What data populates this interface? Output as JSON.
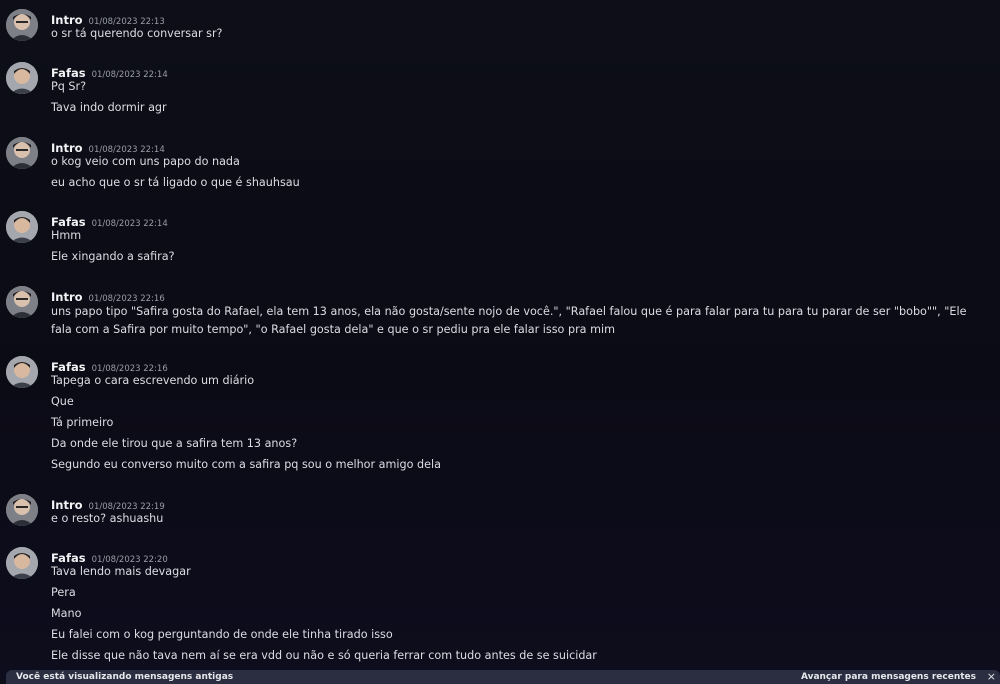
{
  "messages": [
    {
      "author": "Intro",
      "time": "01/08/2023 22:13",
      "avatar": "avatar-intro",
      "lines": [
        "o sr tá querendo conversar sr?"
      ]
    },
    {
      "author": "Fafas",
      "time": "01/08/2023 22:14",
      "avatar": "avatar-fafas",
      "lines": [
        "Pq Sr?",
        "Tava indo dormir agr"
      ]
    },
    {
      "author": "Intro",
      "time": "01/08/2023 22:14",
      "avatar": "avatar-intro",
      "lines": [
        "o kog veio com uns papo do nada",
        "eu acho que o sr tá ligado o que é shauhsau"
      ]
    },
    {
      "author": "Fafas",
      "time": "01/08/2023 22:14",
      "avatar": "avatar-fafas",
      "lines": [
        "Hmm",
        "Ele xingando a safira?"
      ]
    },
    {
      "author": "Intro",
      "time": "01/08/2023 22:16",
      "avatar": "avatar-intro",
      "lines": [
        "uns papo tipo \"Safira gosta do Rafael, ela tem 13 anos, ela não gosta/sente nojo de você.\", \"Rafael falou que é para falar para tu para tu parar de ser \"bobo\"\", \"Ele fala com a Safira por muito tempo\", \"o Rafael gosta dela\" e que o sr pediu pra ele falar isso pra mim"
      ]
    },
    {
      "author": "Fafas",
      "time": "01/08/2023 22:16",
      "avatar": "avatar-fafas",
      "lines": [
        "Tapega o cara escrevendo um diário",
        "Que",
        "Tá primeiro",
        "Da onde ele tirou que a safira tem 13 anos?",
        "Segundo eu converso muito com a safira pq sou o melhor amigo dela"
      ]
    },
    {
      "author": "Intro",
      "time": "01/08/2023 22:19",
      "avatar": "avatar-intro",
      "lines": [
        "e o resto? ashuashu"
      ]
    },
    {
      "author": "Fafas",
      "time": "01/08/2023 22:20",
      "avatar": "avatar-fafas",
      "lines": [
        "Tava lendo mais devagar",
        "Pera",
        "Mano",
        "Eu falei com o kog perguntando de onde ele tinha tirado isso",
        "Ele disse que não tava nem aí se era vdd ou não e só queria ferrar com tudo antes de se suicidar"
      ]
    }
  ],
  "bottom_bar": {
    "left_text": "Você está visualizando mensagens antigas",
    "right_text": "Avançar para mensagens recentes",
    "close_icon": "×"
  },
  "colors": {
    "background": "#0d0e17",
    "text": "#dcdde3",
    "author": "#f2f3f5",
    "timestamp": "#9a9ca5",
    "bar": "#2b2d41"
  }
}
